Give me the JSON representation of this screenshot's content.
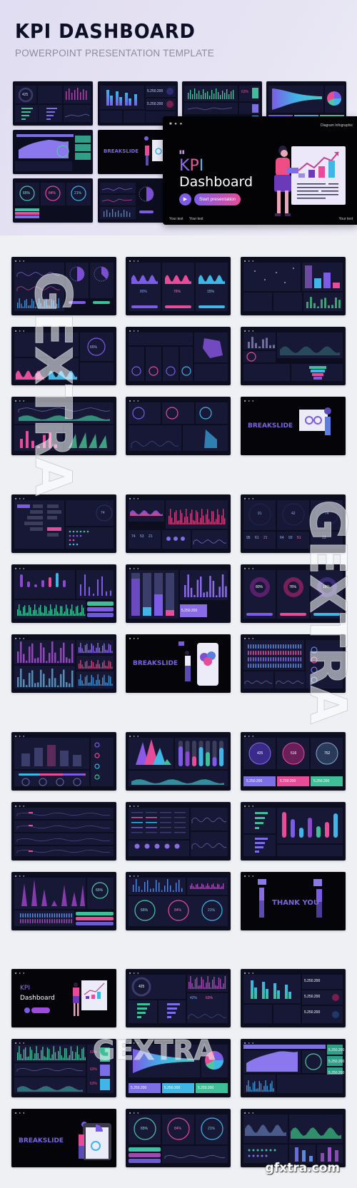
{
  "header": {
    "title": "KPI DASHBOARD",
    "subtitle": "POWERPOINT PRESENTATION TEMPLATE"
  },
  "hero_slide": {
    "header_label": "Diagram Infographic",
    "kpi_letters": [
      "K",
      "P",
      "I"
    ],
    "title": "Dashboard",
    "play_icon": "play-icon",
    "start_button": "Start presentation",
    "footer": [
      "Your text",
      "Your text",
      "Your text"
    ]
  },
  "colors": {
    "purple": "#7c5ce6",
    "pink": "#e64c98",
    "cyan": "#3fb6e6",
    "green": "#3fbf98",
    "slide_bg": "#0c0d1e"
  },
  "preview_values": {
    "currency": "5.250.200",
    "gauges_a": [
      "80%",
      "76%",
      "15%"
    ],
    "gauges_b": [
      "65%",
      "84%",
      "21%"
    ],
    "gauge_single": "65%",
    "scores_big": [
      "91",
      "42",
      "74"
    ],
    "scores_small": [
      "95",
      "61",
      "21",
      "64",
      "93",
      "51",
      "13"
    ],
    "score_74": "74",
    "small_row": [
      "74",
      "53",
      "21"
    ],
    "radial": [
      "425",
      "516",
      "752"
    ],
    "donut": "425",
    "pct_pair": [
      "42%",
      "63%"
    ],
    "pct_63": "63%"
  },
  "slide_labels": {
    "breakslide": "BREAKSLIDE",
    "thank_you": "THANK YOU",
    "kpi": "KPI",
    "dashboard": "Dashboard"
  },
  "watermark": {
    "site": "gfxtra.com",
    "brand": "GEXTRA"
  }
}
